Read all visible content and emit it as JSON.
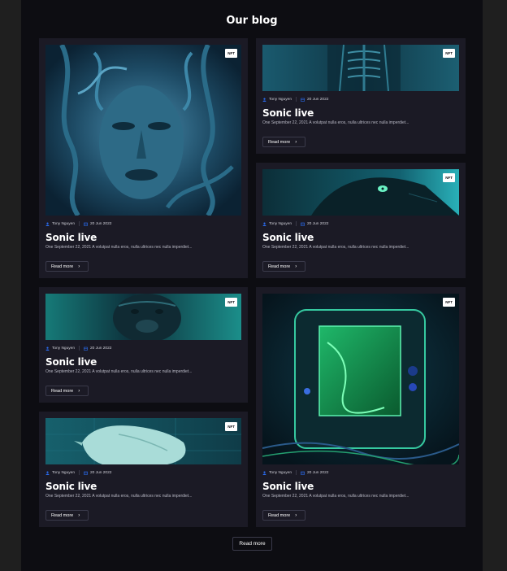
{
  "page": {
    "title": "Our blog",
    "read_more_all": "Read more"
  },
  "colors": {
    "background": "#0d0d12",
    "card": "#1b1a25",
    "accent": "#2a6df4"
  },
  "posts": [
    {
      "badge": "NFT",
      "author": "Tony Nguyen",
      "date": "20 Jun 2022",
      "title": "Sonic live",
      "excerpt": "One September 22, 2021 A volutpat nulla eros, nulla ultrices nec nulla imperdiet...",
      "cta": "Read more",
      "image": "face-portrait"
    },
    {
      "badge": "NFT",
      "author": "Tony Nguyen",
      "date": "20 Jun 2022",
      "title": "Sonic live",
      "excerpt": "One September 22, 2021 A volutpat nulla eros, nulla ultrices nec nulla imperdiet...",
      "cta": "Read more",
      "image": "skeleton"
    },
    {
      "badge": "NFT",
      "author": "Tony Nguyen",
      "date": "20 Jun 2022",
      "title": "Sonic live",
      "excerpt": "One September 22, 2021 A volutpat nulla eros, nulla ultrices nec nulla imperdiet...",
      "cta": "Read more",
      "image": "panther"
    },
    {
      "badge": "NFT",
      "author": "Tony Nguyen",
      "date": "20 Jun 2022",
      "title": "Sonic live",
      "excerpt": "One September 22, 2021 A volutpat nulla eros, nulla ultrices nec nulla imperdiet...",
      "cta": "Read more",
      "image": "gorilla"
    },
    {
      "badge": "NFT",
      "author": "Tony Nguyen",
      "date": "20 Jun 2022",
      "title": "Sonic live",
      "excerpt": "One September 22, 2021 A volutpat nulla eros, nulla ultrices nec nulla imperdiet...",
      "cta": "Read more",
      "image": "game-console"
    },
    {
      "badge": "NFT",
      "author": "Tony Nguyen",
      "date": "20 Jun 2022",
      "title": "Sonic live",
      "excerpt": "One September 22, 2021 A volutpat nulla eros, nulla ultrices nec nulla imperdiet...",
      "cta": "Read more",
      "image": "bird-sculpture"
    }
  ],
  "icons": {
    "author": "user-icon",
    "date": "calendar-icon",
    "cta": "chevron-right-icon"
  }
}
